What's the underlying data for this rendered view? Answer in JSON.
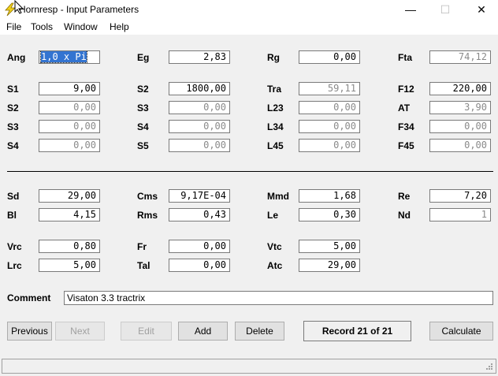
{
  "window": {
    "title": "Hornresp - Input Parameters",
    "controls": {
      "minimize": "—",
      "maximize": "☐",
      "close": "✕"
    }
  },
  "menu": [
    "File",
    "Tools",
    "Window",
    "Help"
  ],
  "fields": {
    "Ang": "1,0 x Pi",
    "Eg": "2,83",
    "Rg": "0,00",
    "Fta": "74,12",
    "S1": "9,00",
    "S2a": "1800,00",
    "Tra": "59,11",
    "F12": "220,00",
    "S2": "0,00",
    "S3a": "0,00",
    "L23": "0,00",
    "AT": "3,90",
    "S3": "0,00",
    "S4a": "0,00",
    "L34": "0,00",
    "F34": "0,00",
    "S4": "0,00",
    "S5": "0,00",
    "L45": "0,00",
    "F45": "0,00",
    "Sd": "29,00",
    "Cms": "9,17E-04",
    "Mmd": "1,68",
    "Re": "7,20",
    "Bl": "4,15",
    "Rms": "0,43",
    "Le": "0,30",
    "Nd": "1",
    "Vrc": "0,80",
    "Fr": "0,00",
    "Vtc": "5,00",
    "Lrc": "5,00",
    "Tal": "0,00",
    "Atc": "29,00"
  },
  "labels": {
    "Ang": "Ang",
    "Eg": "Eg",
    "Rg": "Rg",
    "Fta": "Fta",
    "S1": "S1",
    "S2a": "S2",
    "Tra": "Tra",
    "F12": "F12",
    "S2": "S2",
    "S3a": "S3",
    "L23": "L23",
    "AT": "AT",
    "S3": "S3",
    "S4a": "S4",
    "L34": "L34",
    "F34": "F34",
    "S4": "S4",
    "S5": "S5",
    "L45": "L45",
    "F45": "F45",
    "Sd": "Sd",
    "Cms": "Cms",
    "Mmd": "Mmd",
    "Re": "Re",
    "Bl": "Bl",
    "Rms": "Rms",
    "Le": "Le",
    "Nd": "Nd",
    "Vrc": "Vrc",
    "Fr": "Fr",
    "Vtc": "Vtc",
    "Lrc": "Lrc",
    "Tal": "Tal",
    "Atc": "Atc",
    "Comment": "Comment"
  },
  "comment": "Visaton 3.3 tractrix",
  "buttons": {
    "previous": "Previous",
    "next": "Next",
    "edit": "Edit",
    "add": "Add",
    "delete": "Delete",
    "calculate": "Calculate"
  },
  "record": "Record 21 of 21",
  "colors": {
    "selection": "#3374d1",
    "disabled_text": "#8a8a8a"
  }
}
